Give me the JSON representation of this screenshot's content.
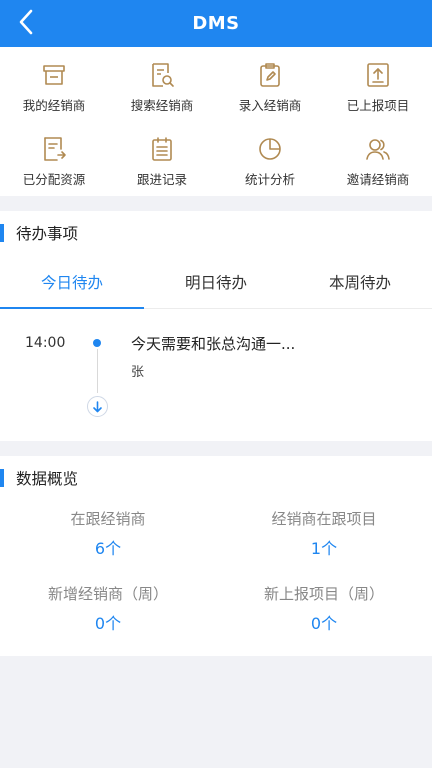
{
  "header": {
    "title": "DMS"
  },
  "grid": {
    "items": [
      {
        "label": "我的经销商",
        "icon": "store-icon"
      },
      {
        "label": "搜索经销商",
        "icon": "search-document-icon"
      },
      {
        "label": "录入经销商",
        "icon": "clipboard-edit-icon"
      },
      {
        "label": "已上报项目",
        "icon": "upload-icon"
      },
      {
        "label": "已分配资源",
        "icon": "assigned-resource-icon"
      },
      {
        "label": "跟进记录",
        "icon": "notes-icon"
      },
      {
        "label": "统计分析",
        "icon": "pie-chart-icon"
      },
      {
        "label": "邀请经销商",
        "icon": "people-icon"
      }
    ],
    "icon_color": "#b08a52"
  },
  "todo": {
    "title": "待办事项",
    "tabs": [
      "今日待办",
      "明日待办",
      "本周待办"
    ],
    "active_tab": "今日待办",
    "items": [
      {
        "time": "14:00",
        "title": "今天需要和张总沟通一...",
        "subtitle": "张"
      }
    ]
  },
  "overview": {
    "title": "数据概览",
    "stats": [
      {
        "label": "在跟经销商",
        "value": "6个"
      },
      {
        "label": "经销商在跟项目",
        "value": "1个"
      },
      {
        "label": "新增经销商（周）",
        "value": "0个"
      },
      {
        "label": "新上报项目（周）",
        "value": "0个"
      }
    ]
  },
  "colors": {
    "primary": "#1f86f0",
    "background": "#f1f2f6"
  }
}
